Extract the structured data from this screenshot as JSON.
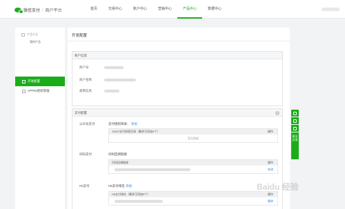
{
  "brand": {
    "name": "微信支付",
    "separator": "|",
    "subtitle": "商户平台"
  },
  "nav": {
    "items": [
      "首页",
      "交易中心",
      "账户中心",
      "营销中心",
      "产品中心",
      "数据中心"
    ],
    "active_index": 4
  },
  "sidebar": {
    "group_label": "产品大全",
    "sub_item": "我的产品",
    "active_item": "开发配置",
    "item_appid": "APPID授权管理"
  },
  "main": {
    "title": "开发配置",
    "merchant_info": {
      "header": "商户信息",
      "merchant_id_label": "商户号",
      "merchant_name_label": "商户名称",
      "category_label": "类目信息"
    },
    "pay_config": {
      "header": "支付配置",
      "help": "?",
      "public_account": {
        "label": "公众号支付",
        "title": "支付授权目录：",
        "add_link": "添加",
        "table_header": "JSAPI支付授权目录（最多可添加5个）",
        "op_label": "操作",
        "empty_text": "暂无数据"
      },
      "scan": {
        "label": "扫码支付",
        "title": "扫码回调链接",
        "table_header": "扫码回调链接",
        "op_label": "操作",
        "edit_link": "修改"
      },
      "h5": {
        "label": "H5支付",
        "title": "H5支付域名",
        "add_link": "添加",
        "table_header": "H5支付域名（最多可添加5个）",
        "op_label": "操作",
        "delete_link": "删除"
      }
    }
  },
  "float_toolbar": {
    "feedback_label": "意见反馈"
  },
  "watermark": "Baidu 经验",
  "colors": {
    "accent": "#1aad19",
    "link": "#2d8cf0"
  }
}
